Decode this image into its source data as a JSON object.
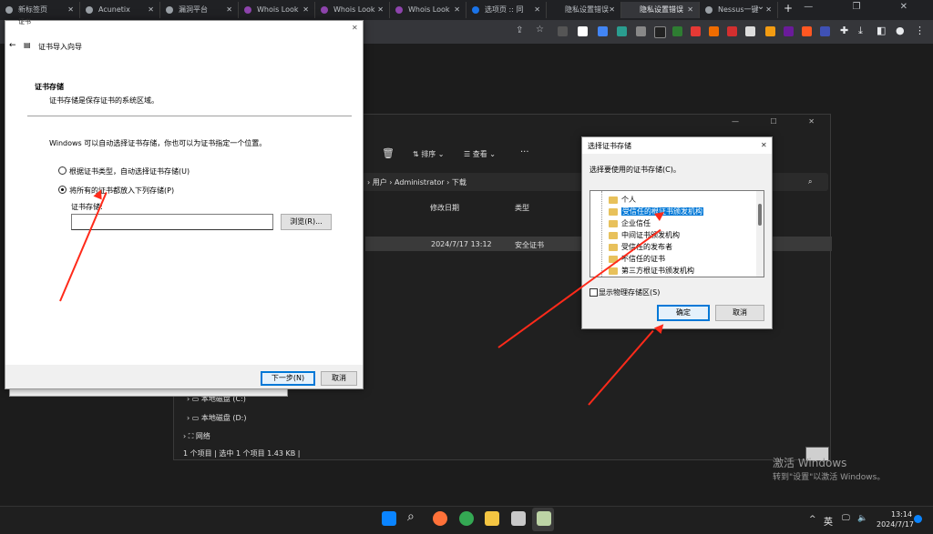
{
  "browser": {
    "tabs": [
      {
        "label": "新标签页"
      },
      {
        "label": "Acunetix"
      },
      {
        "label": "漏洞平台"
      },
      {
        "label": "Whois Look"
      },
      {
        "label": "Whois Look"
      },
      {
        "label": "Whois Look"
      },
      {
        "label": "选项页 :: 同"
      },
      {
        "label": "隐私设置错误"
      },
      {
        "label": "隐私设置错误"
      },
      {
        "label": "Nessus一键"
      }
    ],
    "new_tab": "+",
    "window_controls": "⌄ — ❐ ✕"
  },
  "explorer": {
    "toolbar": {
      "sort": "排序",
      "view": "查看",
      "more": "···"
    },
    "breadcrumb": [
      "用户",
      "Administrator",
      "下载"
    ],
    "columns": [
      "修改日期",
      "类型"
    ],
    "file_row": {
      "date": "2024/7/17 13:12",
      "type": "安全证书"
    },
    "nav_items": [
      "本地磁盘 (C:)",
      "本地磁盘 (D:)",
      "网络"
    ],
    "status": "1 个项目  |  选中 1 个项目  1.43 KB  |",
    "window_controls": "— ☐ ✕"
  },
  "wizard": {
    "title_tab": "证书",
    "title": "证书导入向导",
    "section_title": "证书存储",
    "section_desc": "证书存储是保存证书的系统区域。",
    "intro": "Windows 可以自动选择证书存储，你也可以为证书指定一个位置。",
    "option_auto": "根据证书类型，自动选择证书存储(U)",
    "option_manual": "将所有的证书都放入下列存储(P)",
    "store_label": "证书存储:",
    "store_value": "",
    "browse": "浏览(R)...",
    "next": "下一步(N)",
    "cancel": "取消"
  },
  "dialog": {
    "title": "选择证书存储",
    "prompt": "选择要使用的证书存储(C)。",
    "items": [
      "个人",
      "受信任的根证书颁发机构",
      "企业信任",
      "中间证书颁发机构",
      "受信任的发布者",
      "不信任的证书",
      "第三方根证书颁发机构"
    ],
    "selected_index": 1,
    "show_physical": "显示物理存储区(S)",
    "ok": "确定",
    "cancel": "取消"
  },
  "watermark": {
    "line1": "激活 Windows",
    "line2": "转到\"设置\"以激活 Windows。"
  },
  "taskbar": {
    "lang": "英",
    "time": "13:14",
    "date": "2024/7/17",
    "tray_up": "^"
  },
  "colors": {
    "accent": "#0078d7",
    "annotation": "#ff2a1a",
    "folder": "#e8c15b"
  }
}
